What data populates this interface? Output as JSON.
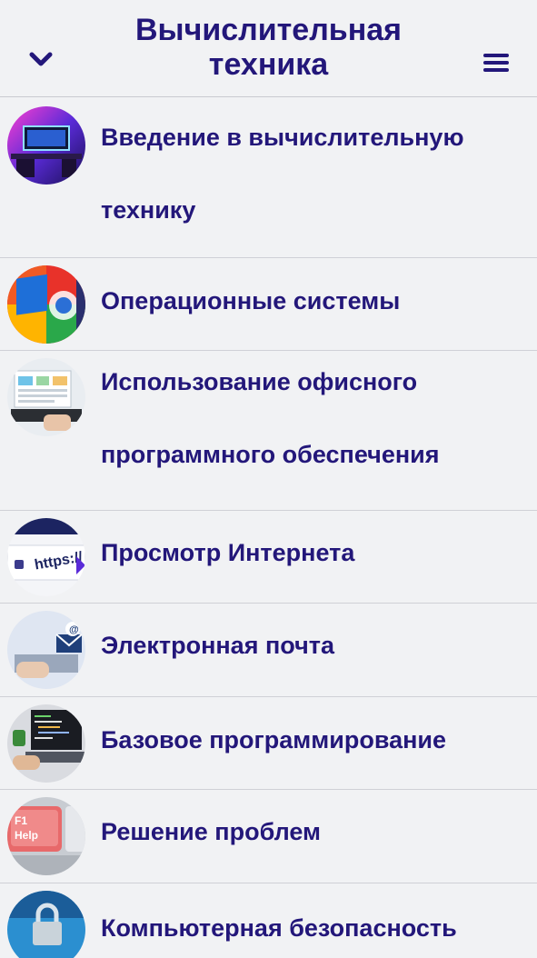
{
  "header": {
    "title": "Вычислительная техника",
    "collapse_icon": "chevron-down-icon",
    "menu_icon": "hamburger-menu-icon"
  },
  "colors": {
    "accent": "#23177a",
    "background": "#f1f2f4",
    "divider": "#cfd0d6"
  },
  "topics": [
    {
      "label": "Введение в вычислительную технику",
      "thumbnail": "gaming-pc-setup-image"
    },
    {
      "label": "Операционные системы",
      "thumbnail": "os-logos-image"
    },
    {
      "label": "Использование офисного программного обеспечения",
      "thumbnail": "laptop-spreadsheet-image"
    },
    {
      "label": "Просмотр Интернета",
      "thumbnail": "https-url-image"
    },
    {
      "label": "Электронная почта",
      "thumbnail": "email-laptop-image"
    },
    {
      "label": "Базовое программирование",
      "thumbnail": "laptop-code-image"
    },
    {
      "label": "Решение проблем",
      "thumbnail": "f1-help-key-image"
    },
    {
      "label": "Компьютерная безопасность",
      "thumbnail": "padlock-network-image"
    }
  ]
}
